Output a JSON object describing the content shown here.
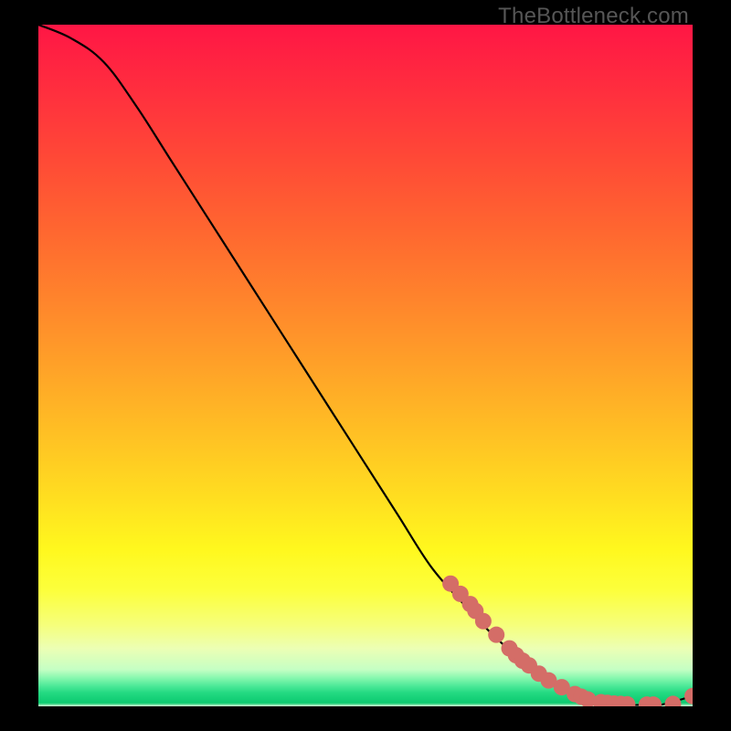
{
  "watermark": "TheBottleneck.com",
  "chart_data": {
    "type": "line",
    "title": "",
    "xlabel": "",
    "ylabel": "",
    "xlim": [
      0,
      100
    ],
    "ylim": [
      0,
      100
    ],
    "series": [
      {
        "name": "curve",
        "x": [
          0,
          5,
          10,
          15,
          20,
          25,
          30,
          35,
          40,
          45,
          50,
          55,
          60,
          65,
          70,
          75,
          80,
          85,
          90,
          92,
          95,
          100
        ],
        "y": [
          100,
          98,
          94.5,
          88,
          80.5,
          73,
          65.5,
          58,
          50.5,
          43,
          35.5,
          28,
          20.5,
          15,
          10,
          6,
          3,
          1.2,
          0.3,
          0.2,
          0.2,
          1.5
        ]
      }
    ],
    "markers": [
      {
        "x": 63.0,
        "y": 18.0
      },
      {
        "x": 64.5,
        "y": 16.5
      },
      {
        "x": 66.0,
        "y": 15.0
      },
      {
        "x": 66.8,
        "y": 14.0
      },
      {
        "x": 68.0,
        "y": 12.5
      },
      {
        "x": 70.0,
        "y": 10.5
      },
      {
        "x": 72.0,
        "y": 8.5
      },
      {
        "x": 73.0,
        "y": 7.5
      },
      {
        "x": 74.0,
        "y": 6.7
      },
      {
        "x": 75.0,
        "y": 6.0
      },
      {
        "x": 76.5,
        "y": 4.8
      },
      {
        "x": 78.0,
        "y": 3.8
      },
      {
        "x": 80.0,
        "y": 2.8
      },
      {
        "x": 82.0,
        "y": 1.8
      },
      {
        "x": 83.0,
        "y": 1.4
      },
      {
        "x": 84.0,
        "y": 1.0
      },
      {
        "x": 86.0,
        "y": 0.6
      },
      {
        "x": 87.0,
        "y": 0.5
      },
      {
        "x": 88.0,
        "y": 0.4
      },
      {
        "x": 89.0,
        "y": 0.35
      },
      {
        "x": 90.0,
        "y": 0.3
      },
      {
        "x": 93.0,
        "y": 0.25
      },
      {
        "x": 94.0,
        "y": 0.25
      },
      {
        "x": 97.0,
        "y": 0.35
      },
      {
        "x": 100.0,
        "y": 1.5
      }
    ],
    "marker_style": {
      "radius": 9,
      "color": "#d46d67"
    },
    "gradient_stops": [
      {
        "offset": 0.0,
        "color": "#ff1645"
      },
      {
        "offset": 0.1,
        "color": "#ff2f3e"
      },
      {
        "offset": 0.2,
        "color": "#ff4a36"
      },
      {
        "offset": 0.3,
        "color": "#ff6630"
      },
      {
        "offset": 0.4,
        "color": "#ff832c"
      },
      {
        "offset": 0.5,
        "color": "#ffa128"
      },
      {
        "offset": 0.6,
        "color": "#ffc024"
      },
      {
        "offset": 0.7,
        "color": "#ffe020"
      },
      {
        "offset": 0.77,
        "color": "#fff81e"
      },
      {
        "offset": 0.83,
        "color": "#fcff3c"
      },
      {
        "offset": 0.88,
        "color": "#f6ff7a"
      },
      {
        "offset": 0.915,
        "color": "#ecffb4"
      },
      {
        "offset": 0.946,
        "color": "#c5ffc4"
      },
      {
        "offset": 0.958,
        "color": "#88f8af"
      },
      {
        "offset": 0.97,
        "color": "#4de998"
      },
      {
        "offset": 0.98,
        "color": "#24da82"
      },
      {
        "offset": 0.995,
        "color": "#0cca70"
      },
      {
        "offset": 1.0,
        "color": "#d8ffd8"
      }
    ]
  }
}
